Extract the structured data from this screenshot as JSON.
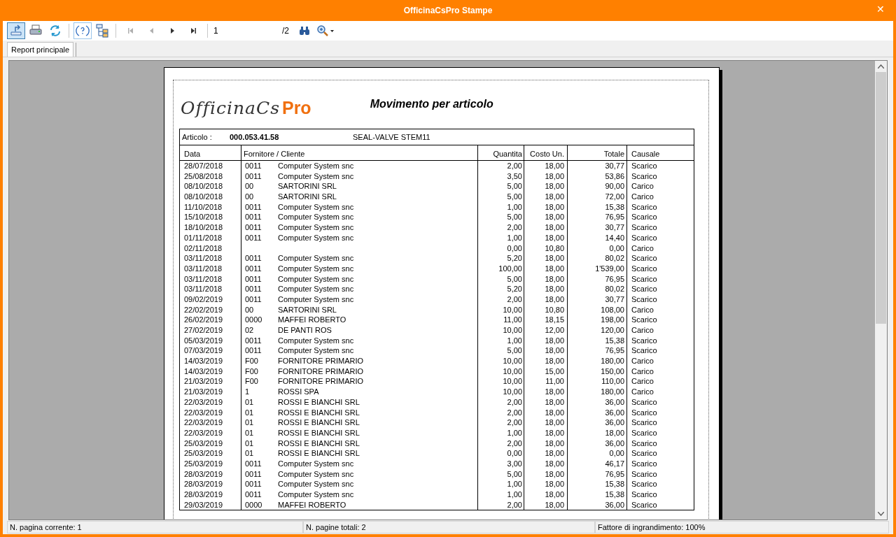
{
  "window": {
    "title": "OfficinaCsPro Stampe",
    "close": "✕"
  },
  "toolbar": {
    "buttons": [
      {
        "kind": "export",
        "pressed": true
      },
      {
        "kind": "print",
        "pressed": false
      },
      {
        "kind": "refresh",
        "pressed": false
      },
      {
        "kind": "sep"
      },
      {
        "kind": "help",
        "pressed": true
      },
      {
        "kind": "tree",
        "pressed": false
      },
      {
        "kind": "sep"
      },
      {
        "kind": "first",
        "pressed": false,
        "disabled": true
      },
      {
        "kind": "prev",
        "pressed": false,
        "disabled": true
      },
      {
        "kind": "next",
        "pressed": false,
        "disabled": false
      },
      {
        "kind": "last",
        "pressed": false,
        "disabled": false
      },
      {
        "kind": "sep"
      }
    ],
    "page_value": "1",
    "page_total": "/2"
  },
  "tabs": [
    {
      "label": "Report principale",
      "selected": true
    }
  ],
  "report": {
    "logo": {
      "name": "OfficinaCs",
      "suffix": "Pro"
    },
    "title": "Movimento per articolo",
    "article": {
      "label": "Articolo :",
      "code": "000.053.41.58",
      "description": "SEAL-VALVE STEM11"
    },
    "columns": [
      "Data",
      "Fornitore / Cliente",
      "Quantita",
      "Costo Un.",
      "Totale",
      "Causale"
    ],
    "rows": [
      {
        "date": "28/07/2018",
        "code": "0011",
        "name": "Computer System snc",
        "qty": "2,00",
        "cost": "18,00",
        "total": "30,77",
        "causale": "Scarico"
      },
      {
        "date": "25/08/2018",
        "code": "0011",
        "name": "Computer System snc",
        "qty": "3,50",
        "cost": "18,00",
        "total": "53,86",
        "causale": "Scarico"
      },
      {
        "date": "08/10/2018",
        "code": "00",
        "name": "SARTORINI SRL",
        "qty": "5,00",
        "cost": "18,00",
        "total": "90,00",
        "causale": "Carico"
      },
      {
        "date": "08/10/2018",
        "code": "00",
        "name": "SARTORINI SRL",
        "qty": "5,00",
        "cost": "18,00",
        "total": "72,00",
        "causale": "Carico"
      },
      {
        "date": "11/10/2018",
        "code": "0011",
        "name": "Computer System snc",
        "qty": "1,00",
        "cost": "18,00",
        "total": "15,38",
        "causale": "Scarico"
      },
      {
        "date": "15/10/2018",
        "code": "0011",
        "name": "Computer System snc",
        "qty": "5,00",
        "cost": "18,00",
        "total": "76,95",
        "causale": "Scarico"
      },
      {
        "date": "18/10/2018",
        "code": "0011",
        "name": "Computer System snc",
        "qty": "2,00",
        "cost": "18,00",
        "total": "30,77",
        "causale": "Scarico"
      },
      {
        "date": "01/11/2018",
        "code": "0011",
        "name": "Computer System snc",
        "qty": "1,00",
        "cost": "18,00",
        "total": "14,40",
        "causale": "Scarico"
      },
      {
        "date": "02/11/2018",
        "code": "",
        "name": "",
        "qty": "0,00",
        "cost": "10,80",
        "total": "0,00",
        "causale": "Carico"
      },
      {
        "date": "03/11/2018",
        "code": "0011",
        "name": "Computer System snc",
        "qty": "5,20",
        "cost": "18,00",
        "total": "80,02",
        "causale": "Scarico"
      },
      {
        "date": "03/11/2018",
        "code": "0011",
        "name": "Computer System snc",
        "qty": "100,00",
        "cost": "18,00",
        "total": "1'539,00",
        "causale": "Scarico"
      },
      {
        "date": "03/11/2018",
        "code": "0011",
        "name": "Computer System snc",
        "qty": "5,00",
        "cost": "18,00",
        "total": "76,95",
        "causale": "Scarico"
      },
      {
        "date": "03/11/2018",
        "code": "0011",
        "name": "Computer System snc",
        "qty": "5,20",
        "cost": "18,00",
        "total": "80,02",
        "causale": "Scarico"
      },
      {
        "date": "09/02/2019",
        "code": "0011",
        "name": "Computer System snc",
        "qty": "2,00",
        "cost": "18,00",
        "total": "30,77",
        "causale": "Scarico"
      },
      {
        "date": "22/02/2019",
        "code": "00",
        "name": "SARTORINI SRL",
        "qty": "10,00",
        "cost": "10,80",
        "total": "108,00",
        "causale": "Carico"
      },
      {
        "date": "26/02/2019",
        "code": "0000",
        "name": "MAFFEI ROBERTO",
        "qty": "11,00",
        "cost": "18,15",
        "total": "198,00",
        "causale": "Scarico"
      },
      {
        "date": "27/02/2019",
        "code": "02",
        "name": "DE PANTI ROS",
        "qty": "10,00",
        "cost": "12,00",
        "total": "120,00",
        "causale": "Carico"
      },
      {
        "date": "05/03/2019",
        "code": "0011",
        "name": "Computer System snc",
        "qty": "1,00",
        "cost": "18,00",
        "total": "15,38",
        "causale": "Scarico"
      },
      {
        "date": "07/03/2019",
        "code": "0011",
        "name": "Computer System snc",
        "qty": "5,00",
        "cost": "18,00",
        "total": "76,95",
        "causale": "Scarico"
      },
      {
        "date": "14/03/2019",
        "code": "F00",
        "name": "FORNITORE PRIMARIO",
        "qty": "10,00",
        "cost": "18,00",
        "total": "180,00",
        "causale": "Carico"
      },
      {
        "date": "14/03/2019",
        "code": "F00",
        "name": "FORNITORE PRIMARIO",
        "qty": "10,00",
        "cost": "15,00",
        "total": "150,00",
        "causale": "Carico"
      },
      {
        "date": "21/03/2019",
        "code": "F00",
        "name": "FORNITORE PRIMARIO",
        "qty": "10,00",
        "cost": "11,00",
        "total": "110,00",
        "causale": "Carico"
      },
      {
        "date": "21/03/2019",
        "code": "1",
        "name": "ROSSI SPA",
        "qty": "10,00",
        "cost": "18,00",
        "total": "180,00",
        "causale": "Carico"
      },
      {
        "date": "22/03/2019",
        "code": "01",
        "name": "ROSSI E BIANCHI SRL",
        "qty": "2,00",
        "cost": "18,00",
        "total": "36,00",
        "causale": "Scarico"
      },
      {
        "date": "22/03/2019",
        "code": "01",
        "name": "ROSSI E BIANCHI SRL",
        "qty": "2,00",
        "cost": "18,00",
        "total": "36,00",
        "causale": "Scarico"
      },
      {
        "date": "22/03/2019",
        "code": "01",
        "name": "ROSSI E BIANCHI SRL",
        "qty": "2,00",
        "cost": "18,00",
        "total": "36,00",
        "causale": "Scarico"
      },
      {
        "date": "22/03/2019",
        "code": "01",
        "name": "ROSSI E BIANCHI SRL",
        "qty": "1,00",
        "cost": "18,00",
        "total": "18,00",
        "causale": "Scarico"
      },
      {
        "date": "25/03/2019",
        "code": "01",
        "name": "ROSSI E BIANCHI SRL",
        "qty": "2,00",
        "cost": "18,00",
        "total": "36,00",
        "causale": "Scarico"
      },
      {
        "date": "25/03/2019",
        "code": "01",
        "name": "ROSSI E BIANCHI SRL",
        "qty": "0,00",
        "cost": "18,00",
        "total": "0,00",
        "causale": "Scarico"
      },
      {
        "date": "25/03/2019",
        "code": "0011",
        "name": "Computer System snc",
        "qty": "3,00",
        "cost": "18,00",
        "total": "46,17",
        "causale": "Scarico"
      },
      {
        "date": "28/03/2019",
        "code": "0011",
        "name": "Computer System snc",
        "qty": "5,00",
        "cost": "18,00",
        "total": "76,95",
        "causale": "Scarico"
      },
      {
        "date": "28/03/2019",
        "code": "0011",
        "name": "Computer System snc",
        "qty": "1,00",
        "cost": "18,00",
        "total": "15,38",
        "causale": "Scarico"
      },
      {
        "date": "28/03/2019",
        "code": "0011",
        "name": "Computer System snc",
        "qty": "1,00",
        "cost": "18,00",
        "total": "15,38",
        "causale": "Scarico"
      },
      {
        "date": "29/03/2019",
        "code": "0000",
        "name": "MAFFEI ROBERTO",
        "qty": "2,00",
        "cost": "18,00",
        "total": "36,00",
        "causale": "Scarico"
      }
    ]
  },
  "status_bar": [
    "N. pagina corrente: 1",
    "N. pagine totali: 2",
    "Fattore di ingrandimento: 100%"
  ]
}
